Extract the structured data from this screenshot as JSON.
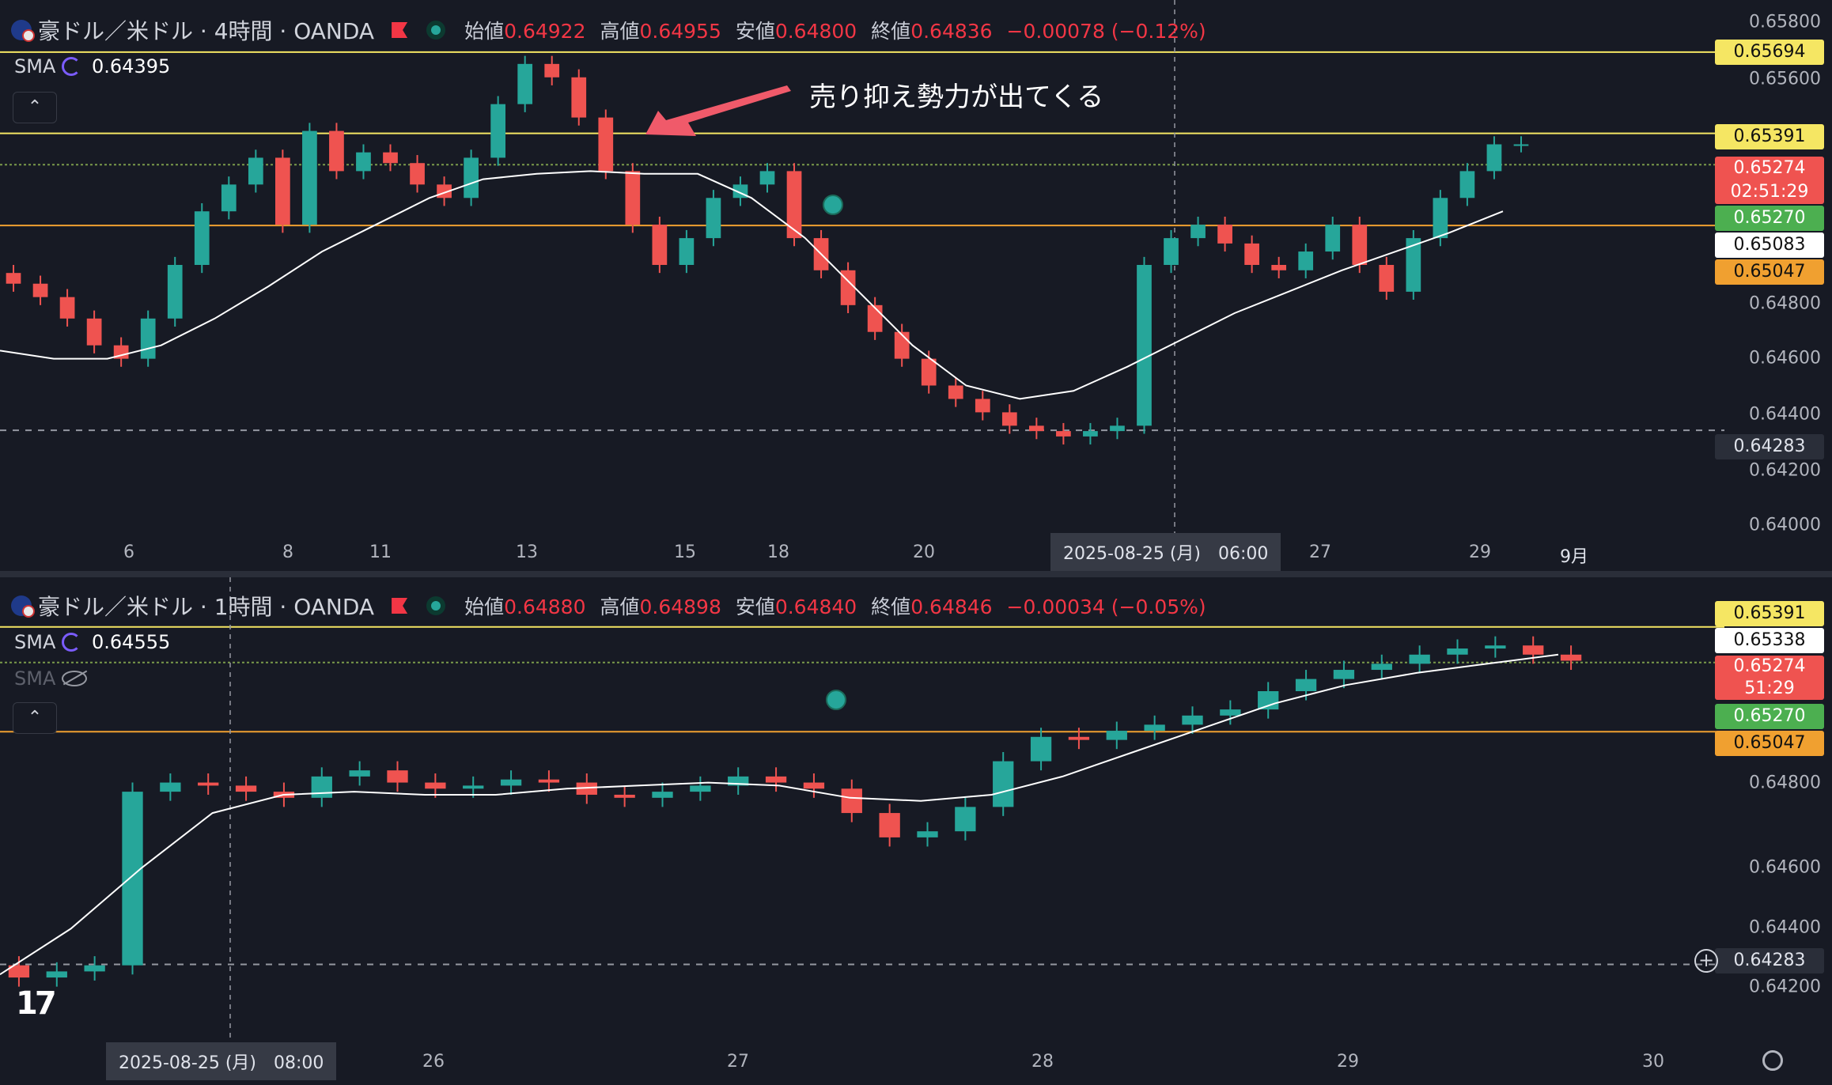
{
  "charts": [
    {
      "symbol_title": "豪ドル／米ドル · 4時間 · OANDA",
      "ohlc": {
        "open_label": "始値",
        "open": "0.64922",
        "high_label": "高値",
        "high": "0.64955",
        "low_label": "安値",
        "low": "0.64800",
        "close_label": "終値",
        "close": "0.64836",
        "change": "−0.00078 (−0.12%)"
      },
      "sma_label": "SMA",
      "sma_value": "0.64395",
      "annotation": "売り抑え勢力が出てくる",
      "crosshair_date": "2025-08-25 (月)　06:00",
      "y_axis_labels": [
        "0.65800",
        "0.65600",
        "0.64800",
        "0.64600",
        "0.64400",
        "0.64200",
        "0.64000"
      ],
      "price_tags": [
        {
          "text": "0.65694",
          "style": "yellow"
        },
        {
          "text": "0.65391",
          "style": "yellow"
        },
        {
          "text": "0.65274",
          "sub": "02:51:29",
          "style": "red"
        },
        {
          "text": "0.65270",
          "style": "green"
        },
        {
          "text": "0.65083",
          "style": "white"
        },
        {
          "text": "0.65047",
          "style": "orange"
        },
        {
          "text": "0.64283",
          "style": "gray"
        }
      ],
      "x_labels": [
        "6",
        "8",
        "11",
        "13",
        "15",
        "18",
        "20",
        "27",
        "29",
        "9月"
      ]
    },
    {
      "symbol_title": "豪ドル／米ドル · 1時間 · OANDA",
      "ohlc": {
        "open_label": "始値",
        "open": "0.64880",
        "high_label": "高値",
        "high": "0.64898",
        "low_label": "安値",
        "low": "0.64840",
        "close_label": "終値",
        "close": "0.64846",
        "change": "−0.00034 (−0.05%)"
      },
      "sma_label": "SMA",
      "sma_value": "0.64555",
      "sma2_label": "SMA",
      "crosshair_date": "2025-08-25 (月)　08:00",
      "y_axis_labels": [
        "0.64800",
        "0.64600",
        "0.64400",
        "0.64200"
      ],
      "price_tags": [
        {
          "text": "0.65391",
          "style": "yellow"
        },
        {
          "text": "0.65338",
          "style": "white"
        },
        {
          "text": "0.65274",
          "sub": "51:29",
          "style": "red"
        },
        {
          "text": "0.65270",
          "style": "green"
        },
        {
          "text": "0.65047",
          "style": "orange"
        },
        {
          "text": "0.64283",
          "style": "gray"
        }
      ],
      "x_labels": [
        "26",
        "27",
        "28",
        "29",
        "30"
      ]
    }
  ],
  "colors": {
    "up": "#26a69a",
    "down": "#ef5350",
    "hline_yellow": "#f5e663",
    "hline_orange": "#f0a030",
    "sma": "#ffffff",
    "bg": "#171a24"
  },
  "chart_data": [
    {
      "type": "candlestick",
      "title": "豪ドル／米ドル · 4時間 · OANDA",
      "ylim": [
        0.64,
        0.658
      ],
      "close_series_approx": [
        0.6483,
        0.6478,
        0.647,
        0.646,
        0.6455,
        0.647,
        0.649,
        0.651,
        0.652,
        0.653,
        0.6505,
        0.654,
        0.6525,
        0.6532,
        0.6528,
        0.652,
        0.6515,
        0.653,
        0.655,
        0.6565,
        0.656,
        0.6545,
        0.6525,
        0.6505,
        0.649,
        0.65,
        0.6515,
        0.652,
        0.6525,
        0.65,
        0.6488,
        0.6475,
        0.6465,
        0.6455,
        0.6445,
        0.644,
        0.6435,
        0.643,
        0.6428,
        0.6426,
        0.6428,
        0.643,
        0.649,
        0.65,
        0.6505,
        0.6498,
        0.649,
        0.6488,
        0.6495,
        0.6505,
        0.649,
        0.648,
        0.65,
        0.6515,
        0.6525,
        0.6535,
        0.6535
      ],
      "sma_approx": [
        0.6458,
        0.6455,
        0.6455,
        0.646,
        0.647,
        0.6482,
        0.6495,
        0.6505,
        0.6515,
        0.6522,
        0.6524,
        0.6525,
        0.6524,
        0.6524,
        0.6515,
        0.65,
        0.648,
        0.646,
        0.6445,
        0.644,
        0.6443,
        0.6452,
        0.6462,
        0.6472,
        0.648,
        0.6488,
        0.6495,
        0.6502,
        0.651
      ]
    },
    {
      "type": "candlestick",
      "title": "豪ドル／米ドル · 1時間 · OANDA",
      "ylim": [
        0.641,
        0.6545
      ],
      "close_series_approx": [
        0.6424,
        0.6426,
        0.6428,
        0.6485,
        0.6488,
        0.6487,
        0.6485,
        0.6483,
        0.649,
        0.6492,
        0.6488,
        0.6486,
        0.6487,
        0.6489,
        0.6488,
        0.6484,
        0.6483,
        0.6485,
        0.6487,
        0.649,
        0.6488,
        0.6486,
        0.6478,
        0.647,
        0.6472,
        0.648,
        0.6495,
        0.6503,
        0.6502,
        0.6505,
        0.6507,
        0.651,
        0.6512,
        0.6518,
        0.6522,
        0.6525,
        0.6527,
        0.653,
        0.6532,
        0.6533,
        0.653,
        0.6528
      ],
      "sma_approx": [
        0.6425,
        0.644,
        0.646,
        0.6478,
        0.6484,
        0.6485,
        0.6484,
        0.6484,
        0.6486,
        0.6487,
        0.6488,
        0.6487,
        0.6483,
        0.6482,
        0.6484,
        0.649,
        0.6498,
        0.6506,
        0.6514,
        0.652,
        0.6524,
        0.6527,
        0.653
      ]
    }
  ]
}
